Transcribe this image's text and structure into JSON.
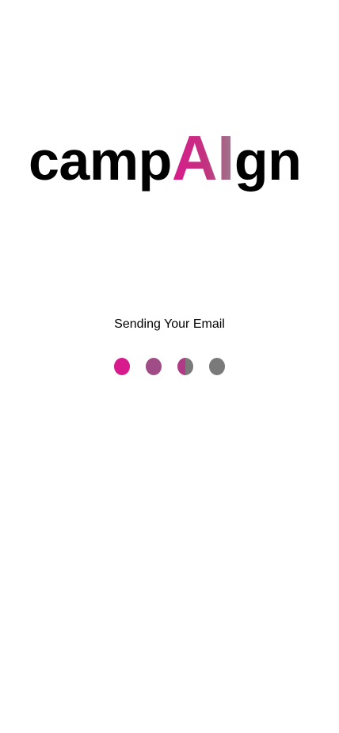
{
  "logo": {
    "part1": "camp",
    "part2": "AI",
    "part3": "gn"
  },
  "status": {
    "text": "Sending Your Email"
  },
  "loader": {
    "dots": [
      {
        "fill": "#d81b8c"
      },
      {
        "fill": "#a04c86"
      },
      {
        "fill_left": "#b13a87",
        "fill_right": "#7a7a7a"
      },
      {
        "fill": "#7a7a7a"
      }
    ]
  },
  "colors": {
    "accent": "#d81b8c",
    "muted": "#7a7a7a",
    "text": "#000000",
    "background": "#ffffff"
  }
}
